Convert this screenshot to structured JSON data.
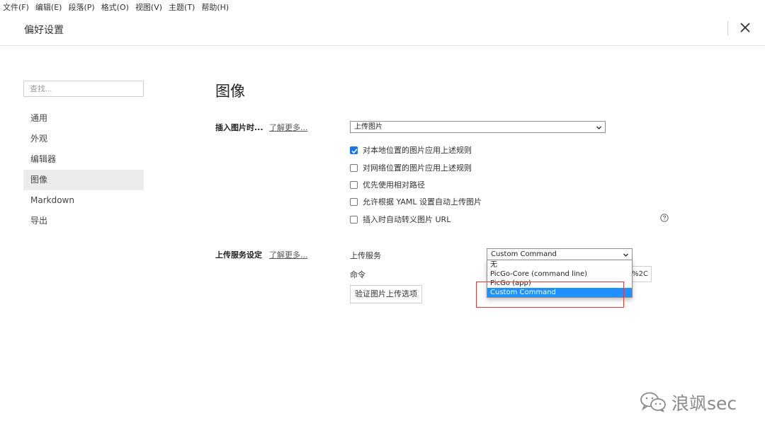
{
  "menubar": {
    "items": [
      "文件(F)",
      "编辑(E)",
      "段落(P)",
      "格式(O)",
      "视图(V)",
      "主题(T)",
      "帮助(H)"
    ]
  },
  "header": {
    "title": "偏好设置",
    "close_icon": "close-icon"
  },
  "search": {
    "placeholder": "查找..."
  },
  "nav": {
    "items": [
      "通用",
      "外观",
      "编辑器",
      "图像",
      "Markdown",
      "导出"
    ],
    "active": "图像"
  },
  "main": {
    "title": "图像",
    "insert": {
      "label": "插入图片时...",
      "learn_more": "了解更多...",
      "selected": "上传图片"
    },
    "checkboxes": [
      {
        "label": "对本地位置的图片应用上述规则",
        "checked": true
      },
      {
        "label": "对网络位置的图片应用上述规则",
        "checked": false
      },
      {
        "label": "优先使用相对路径",
        "checked": false
      },
      {
        "label": "允许根据 YAML 设置自动上传图片",
        "checked": false
      },
      {
        "label": "插入时自动转义图片 URL",
        "checked": false
      }
    ],
    "help_icon": "question-circle-icon",
    "upload": {
      "label": "上传服务设定",
      "learn_more": "了解更多...",
      "service_label": "上传服务",
      "service_selected": "Custom Command",
      "service_options": [
        "无",
        "PicGo-Core (command line)",
        "PicGo (app)",
        "Custom Command"
      ],
      "command_label": "命令",
      "command_value": "1%2C",
      "verify_button": "验证图片上传选项"
    }
  },
  "watermark": {
    "text": "浪飒sec"
  },
  "colors": {
    "accent": "#1e90ff",
    "highlight": "#e53935",
    "active_nav": "#ececec"
  }
}
